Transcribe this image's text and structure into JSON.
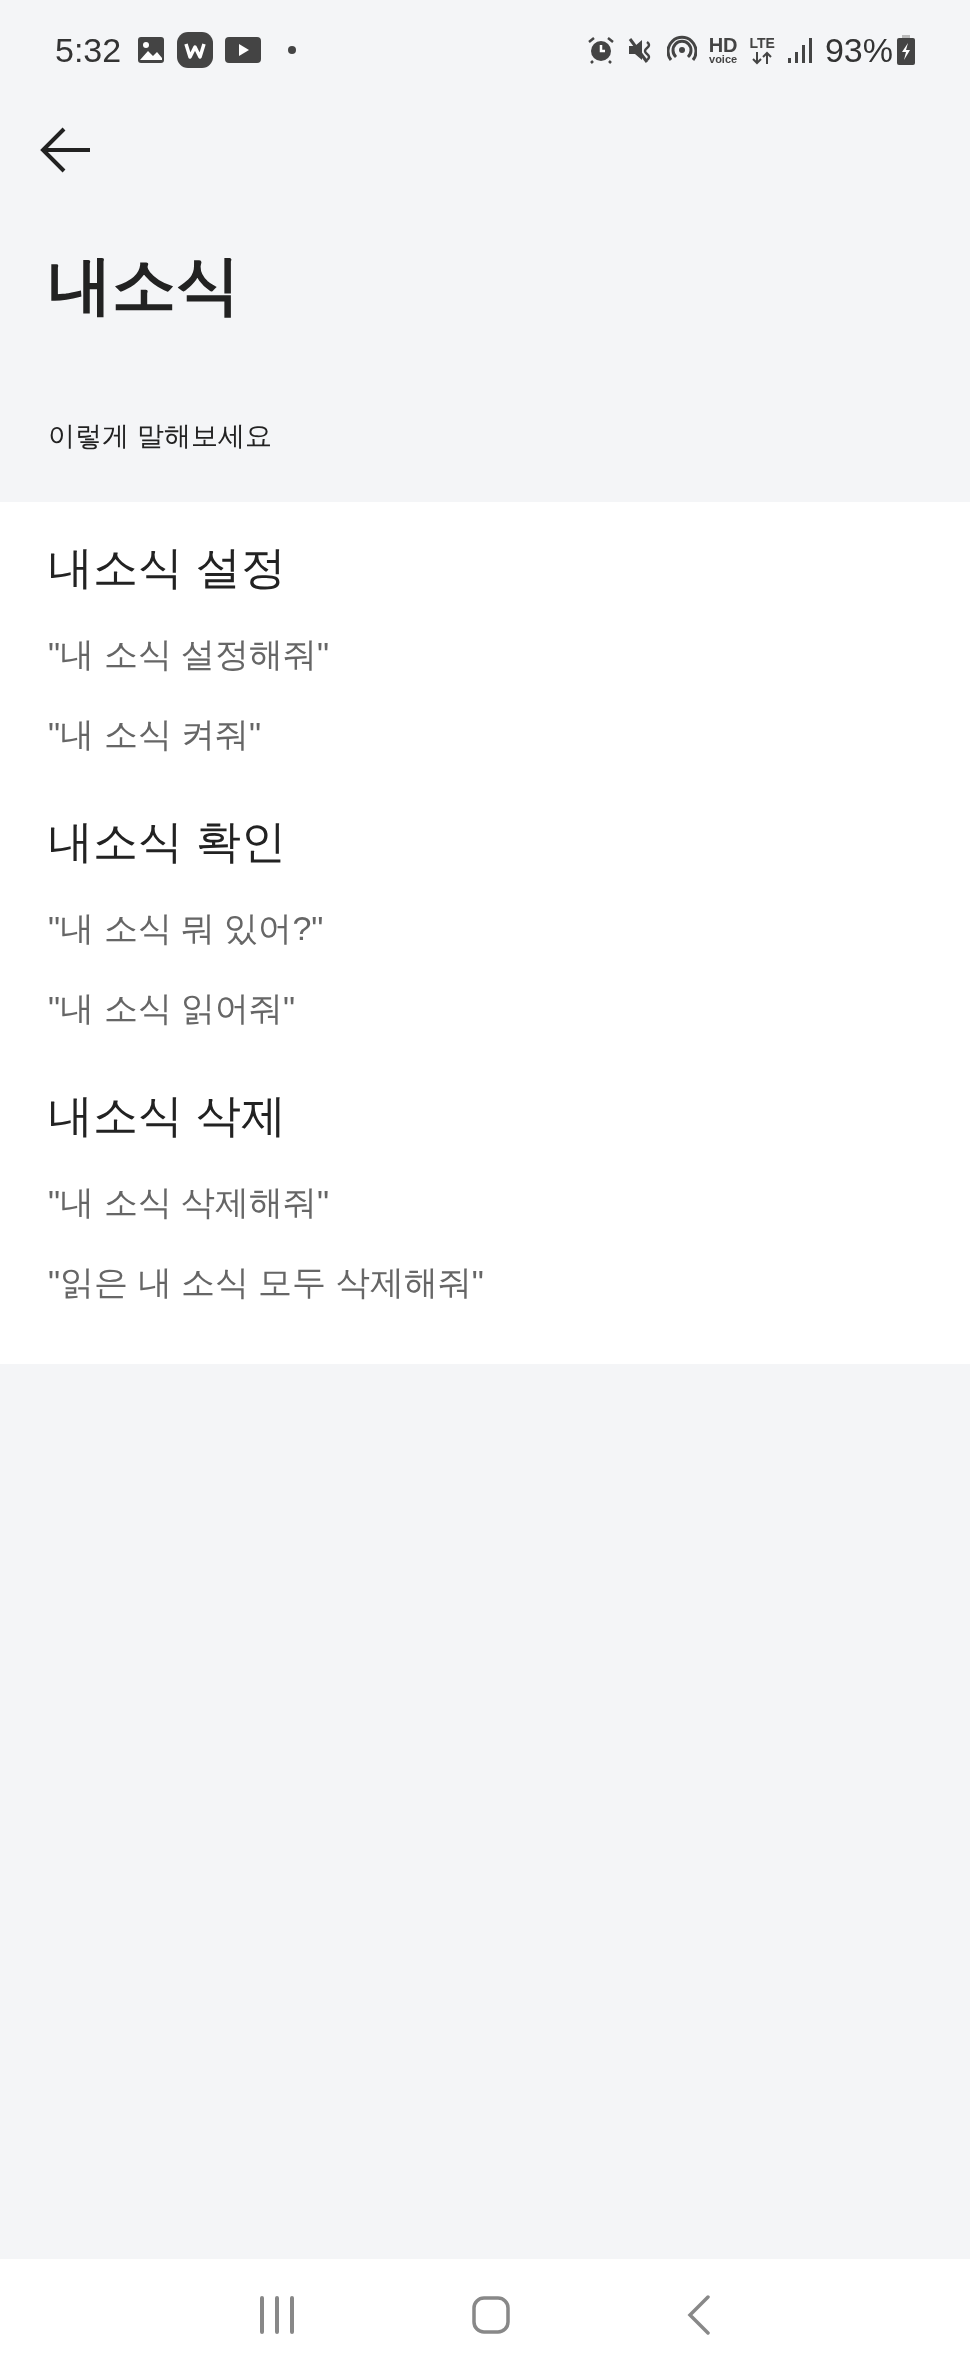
{
  "status_bar": {
    "time": "5:32",
    "network_hd": "HD",
    "network_voice": "voice",
    "network_type": "LTE",
    "battery": "93%"
  },
  "header": {
    "title": "내소식",
    "subtitle": "이렇게 말해보세요"
  },
  "sections": [
    {
      "heading": "내소식 설정",
      "examples": [
        "\"내 소식 설정해줘\"",
        "\"내 소식 켜줘\""
      ]
    },
    {
      "heading": "내소식 확인",
      "examples": [
        "\"내 소식 뭐 있어?\"",
        "\"내 소식 읽어줘\""
      ]
    },
    {
      "heading": "내소식 삭제",
      "examples": [
        "\"내 소식 삭제해줘\"",
        "\"읽은 내 소식 모두 삭제해줘\""
      ]
    }
  ]
}
